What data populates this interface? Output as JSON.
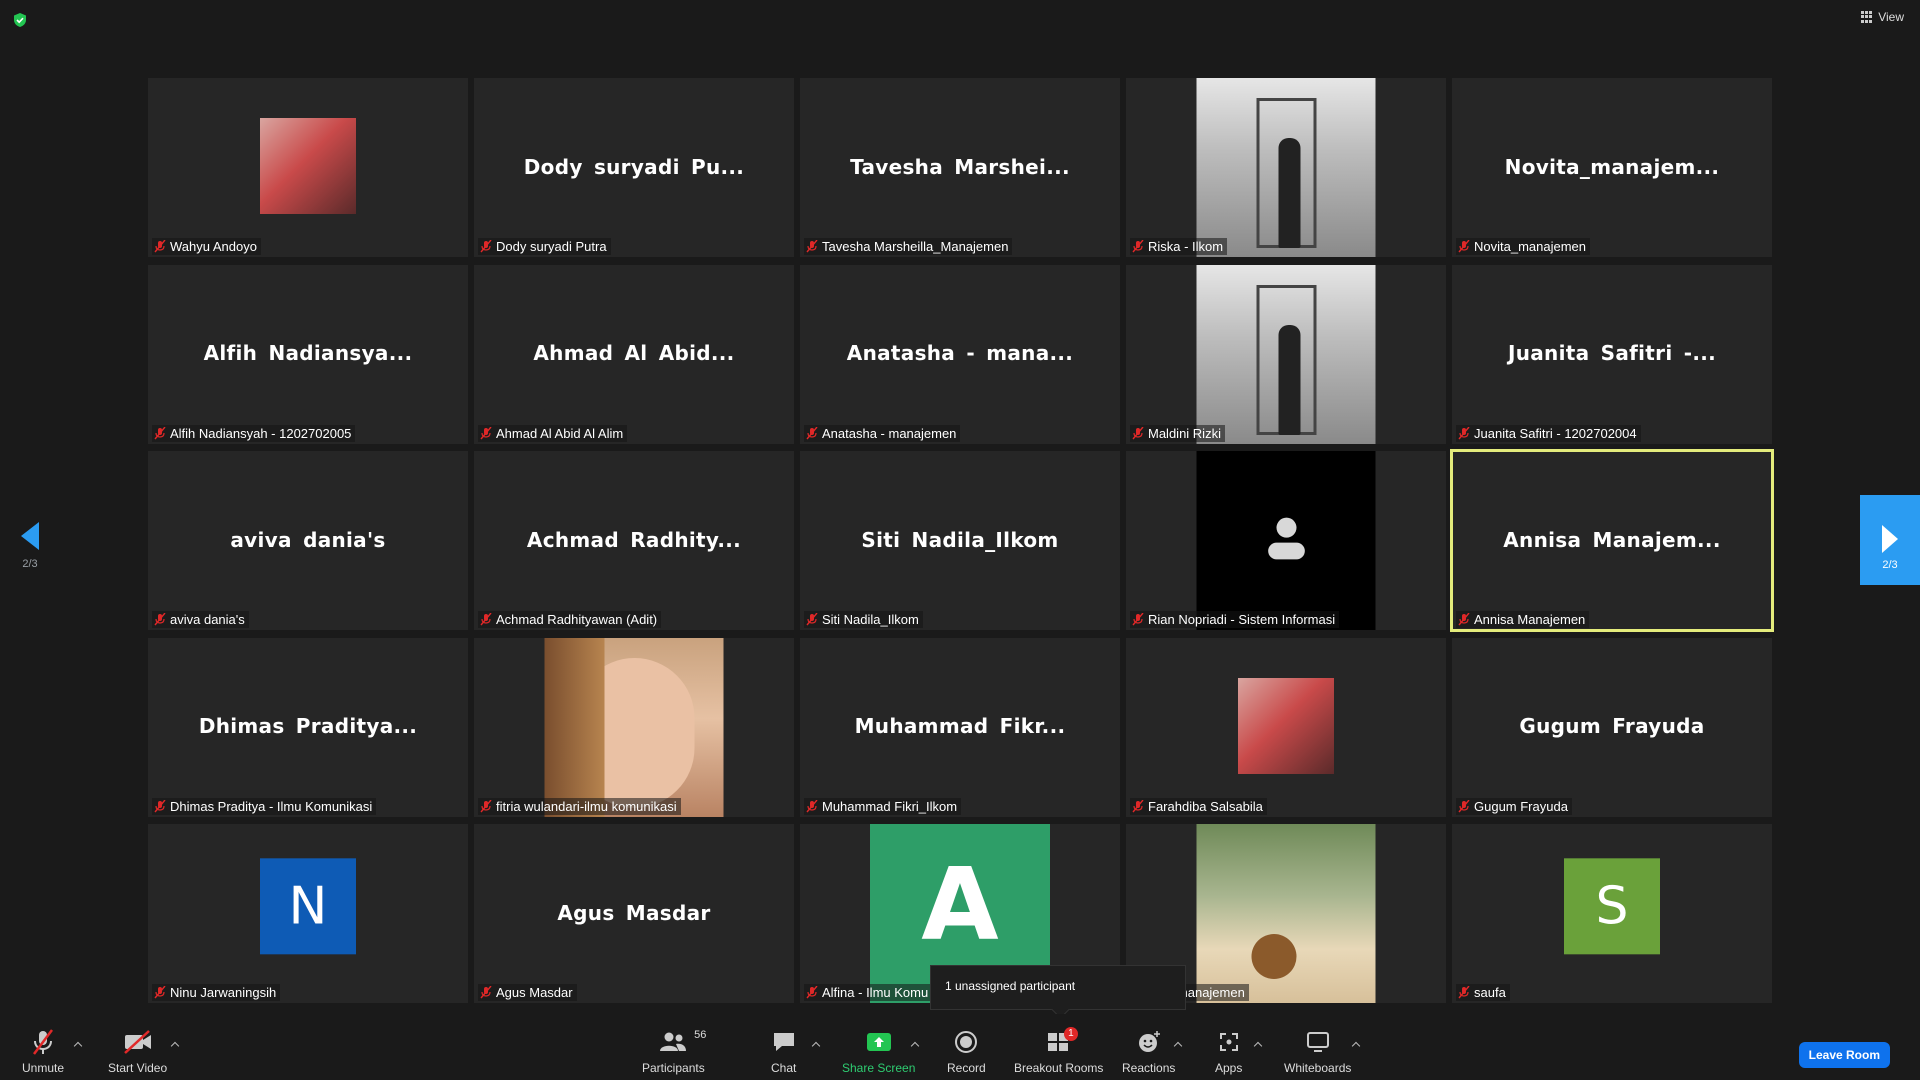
{
  "top": {
    "view_label": "View"
  },
  "colors": {
    "accent_blue": "#2b9cf2",
    "active_speaker": "#e4ec7c",
    "leave": "#0e72ed",
    "muted_red": "#e02828"
  },
  "pagination": {
    "left_page": "2/3",
    "right_page": "2/3"
  },
  "tooltip": "1 unassigned participant",
  "tiles": [
    {
      "display": "",
      "name": "Wahyu Andoyo",
      "kind": "photo-small"
    },
    {
      "display": "Dody suryadi Pu...",
      "name": "Dody suryadi Putra",
      "kind": "name"
    },
    {
      "display": "Tavesha Marshei...",
      "name": "Tavesha Marsheilla_Manajemen",
      "kind": "name"
    },
    {
      "display": "",
      "name": "Riska - Ilkom",
      "kind": "video"
    },
    {
      "display": "Novita_manajem...",
      "name": "Novita_manajemen",
      "kind": "name"
    },
    {
      "display": "Alfih Nadiansya...",
      "name": "Alfih Nadiansyah - 1202702005",
      "kind": "name"
    },
    {
      "display": "Ahmad Al Abid...",
      "name": "Ahmad Al Abid Al Alim",
      "kind": "name"
    },
    {
      "display": "Anatasha - mana...",
      "name": "Anatasha - manajemen",
      "kind": "name"
    },
    {
      "display": "",
      "name": "Maldini Rizki",
      "kind": "video"
    },
    {
      "display": "Juanita Safitri -...",
      "name": "Juanita Safitri - 1202702004",
      "kind": "name"
    },
    {
      "display": "aviva dania's",
      "name": "aviva dania's",
      "kind": "name"
    },
    {
      "display": "Achmad Radhity...",
      "name": "Achmad Radhityawan (Adit)",
      "kind": "name"
    },
    {
      "display": "Siti Nadila_Ilkom",
      "name": "Siti Nadila_Ilkom",
      "kind": "name"
    },
    {
      "display": "",
      "name": "Rian Nopriadi - Sistem Informasi",
      "kind": "placeholder"
    },
    {
      "display": "Annisa Manajem...",
      "name": "Annisa Manajemen",
      "kind": "name",
      "active": true
    },
    {
      "display": "Dhimas Praditya...",
      "name": "Dhimas Praditya - Ilmu Komunikasi",
      "kind": "name"
    },
    {
      "display": "",
      "name": "fitria wulandari-ilmu komunikasi",
      "kind": "video-face"
    },
    {
      "display": "Muhammad Fikr...",
      "name": "Muhammad Fikri_Ilkom",
      "kind": "name"
    },
    {
      "display": "",
      "name": "Farahdiba Salsabila",
      "kind": "photo-small"
    },
    {
      "display": "Gugum Frayuda",
      "name": "Gugum Frayuda",
      "kind": "name"
    },
    {
      "display": "N",
      "name": "Ninu Jarwaningsih",
      "kind": "letter",
      "color": "#0e5bb5"
    },
    {
      "display": "Agus Masdar",
      "name": "Agus Masdar",
      "kind": "name"
    },
    {
      "display": "A",
      "name": "Alfina - Ilmu Komu",
      "kind": "letter-large",
      "color": "#2e9e68"
    },
    {
      "display": "",
      "name": "kbar manajemen",
      "kind": "video-beach"
    },
    {
      "display": "S",
      "name": "saufa",
      "kind": "letter",
      "color": "#6aa13a"
    }
  ],
  "toolbar": {
    "unmute": "Unmute",
    "start_video": "Start Video",
    "participants": "Participants",
    "participants_count": "56",
    "chat": "Chat",
    "share_screen": "Share Screen",
    "record": "Record",
    "breakout_rooms": "Breakout Rooms",
    "breakout_badge": "1",
    "reactions": "Reactions",
    "apps": "Apps",
    "whiteboards": "Whiteboards",
    "leave": "Leave Room"
  }
}
